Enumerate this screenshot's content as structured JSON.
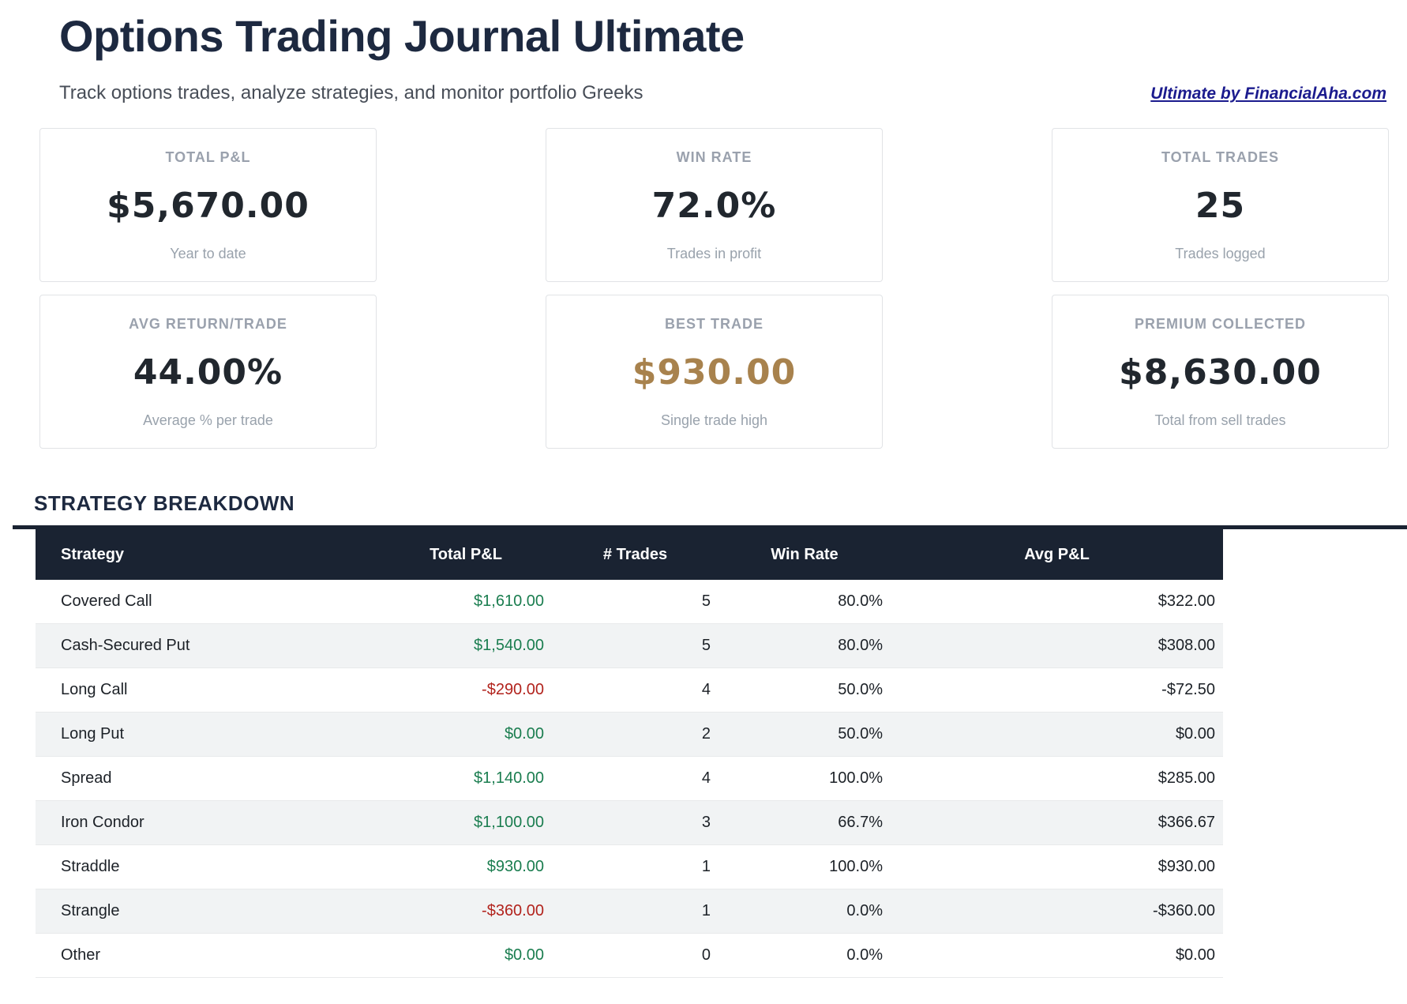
{
  "header": {
    "title": "Options Trading Journal Ultimate",
    "subtitle": "Track options trades, analyze strategies, and monitor portfolio Greeks",
    "link_text": "Ultimate by FinancialAha.com"
  },
  "colors": {
    "navy": "#1a2332",
    "title": "#1d2940",
    "green": "#1a7d4f",
    "red": "#b2231d",
    "gold": "#a8824d",
    "link": "#1b1b8e"
  },
  "stats": [
    {
      "id": "total-pl",
      "label": "TOTAL P&L",
      "value": "$5,670.00",
      "caption": "Year to date",
      "accent": "dark"
    },
    {
      "id": "win-rate",
      "label": "WIN RATE",
      "value": "72.0%",
      "caption": "Trades in profit",
      "accent": "dark"
    },
    {
      "id": "total-trades",
      "label": "TOTAL TRADES",
      "value": "25",
      "caption": "Trades logged",
      "accent": "dark"
    },
    {
      "id": "avg-return-trade",
      "label": "AVG RETURN/TRADE",
      "value": "44.00%",
      "caption": "Average % per trade",
      "accent": "dark"
    },
    {
      "id": "best-trade",
      "label": "BEST TRADE",
      "value": "$930.00",
      "caption": "Single trade high",
      "accent": "gold"
    },
    {
      "id": "premium-collected",
      "label": "PREMIUM COLLECTED",
      "value": "$8,630.00",
      "caption": "Total from sell trades",
      "accent": "dark"
    }
  ],
  "table": {
    "section_title": "STRATEGY BREAKDOWN",
    "headers": [
      "Strategy",
      "Total P&L",
      "# Trades",
      "Win Rate",
      "Avg P&L"
    ],
    "rows": [
      {
        "strategy": "Covered Call",
        "total_pnl": "$1,610.00",
        "pnl_color": "green",
        "trades": "5",
        "win_rate": "80.0%",
        "avg_pnl": "$322.00"
      },
      {
        "strategy": "Cash-Secured Put",
        "total_pnl": "$1,540.00",
        "pnl_color": "green",
        "trades": "5",
        "win_rate": "80.0%",
        "avg_pnl": "$308.00"
      },
      {
        "strategy": "Long Call",
        "total_pnl": "-$290.00",
        "pnl_color": "red",
        "trades": "4",
        "win_rate": "50.0%",
        "avg_pnl": "-$72.50"
      },
      {
        "strategy": "Long Put",
        "total_pnl": "$0.00",
        "pnl_color": "green",
        "trades": "2",
        "win_rate": "50.0%",
        "avg_pnl": "$0.00"
      },
      {
        "strategy": "Spread",
        "total_pnl": "$1,140.00",
        "pnl_color": "green",
        "trades": "4",
        "win_rate": "100.0%",
        "avg_pnl": "$285.00"
      },
      {
        "strategy": "Iron Condor",
        "total_pnl": "$1,100.00",
        "pnl_color": "green",
        "trades": "3",
        "win_rate": "66.7%",
        "avg_pnl": "$366.67"
      },
      {
        "strategy": "Straddle",
        "total_pnl": "$930.00",
        "pnl_color": "green",
        "trades": "1",
        "win_rate": "100.0%",
        "avg_pnl": "$930.00"
      },
      {
        "strategy": "Strangle",
        "total_pnl": "-$360.00",
        "pnl_color": "red",
        "trades": "1",
        "win_rate": "0.0%",
        "avg_pnl": "-$360.00"
      },
      {
        "strategy": "Other",
        "total_pnl": "$0.00",
        "pnl_color": "green",
        "trades": "0",
        "win_rate": "0.0%",
        "avg_pnl": "$0.00"
      }
    ]
  }
}
